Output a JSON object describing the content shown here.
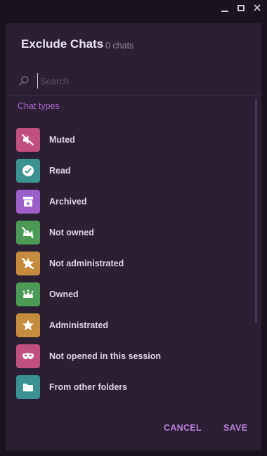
{
  "window": {
    "minimize_icon": "minimize-icon",
    "maximize_icon": "maximize-icon",
    "close_icon": "close-icon"
  },
  "dialog": {
    "title": "Exclude Chats",
    "count": "0 chats",
    "search": {
      "placeholder": "Search",
      "value": ""
    },
    "section_label": "Chat types",
    "items": [
      {
        "label": "Muted",
        "icon": "muted-icon",
        "color": "#c0507e"
      },
      {
        "label": "Read",
        "icon": "read-icon",
        "color": "#3b9291"
      },
      {
        "label": "Archived",
        "icon": "archive-icon",
        "color": "#9c5fca"
      },
      {
        "label": "Not owned",
        "icon": "not-owned-icon",
        "color": "#4d9a57"
      },
      {
        "label": "Not administrated",
        "icon": "not-admin-icon",
        "color": "#c48c3c"
      },
      {
        "label": "Owned",
        "icon": "crown-icon",
        "color": "#4d9a57"
      },
      {
        "label": "Administrated",
        "icon": "star-icon",
        "color": "#c48c3c"
      },
      {
        "label": "Not opened in this session",
        "icon": "mask-icon",
        "color": "#c0507e"
      },
      {
        "label": "From other folders",
        "icon": "folder-icon",
        "color": "#3b9291"
      }
    ],
    "cancel_label": "CANCEL",
    "save_label": "SAVE"
  },
  "colors": {
    "background": "#1b1320",
    "dialog": "#2b1f33",
    "accent": "#b77fd6",
    "section": "#a768c6"
  }
}
